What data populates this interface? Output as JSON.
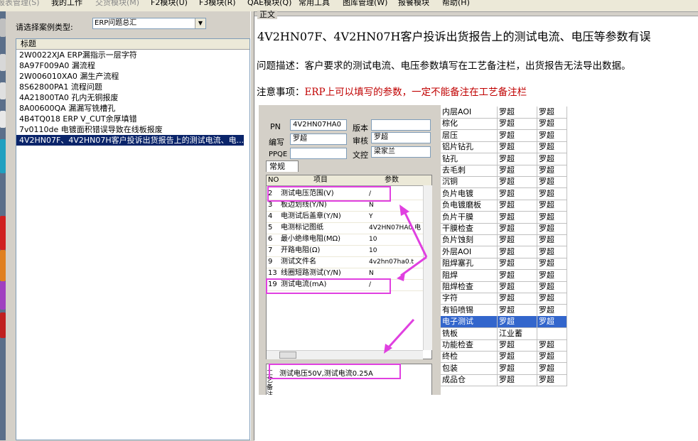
{
  "menubar": {
    "items": [
      "报表管理(S)",
      "我的工作",
      "交货模块(M)",
      "F2模块(U)",
      "F3模块(R)",
      "QAE模块(Q)",
      "常用工具",
      "图库管理(W)",
      "报餐模块",
      "帮助(H)"
    ]
  },
  "left": {
    "case_type_label": "请选择案例类型:",
    "case_type_value": "ERP问题总汇",
    "list_header": "标题",
    "items": [
      "2W0022XJA  ERP漏指示一层字符",
      "8A97F009A0  漏流程",
      "2W006010XA0 漏生产流程",
      "8S62800PA1 流程问题",
      "4A21800TA0    孔内无铜报废",
      "8A00600QA 漏漏写铣槽孔",
      "4B4TQ018 ERP V_CUT余厚填错",
      "7v0110de    电镀面积错误导致在线板报废",
      "4V2HN07F、4V2HN07H客户投诉出货报告上的测试电流、电..."
    ],
    "selected_index": 8
  },
  "content": {
    "legend": "正文",
    "title": "4V2HN07F、4V2HN07H客户投诉出货报告上的测试电流、电压等参数有误",
    "description": "问题描述：客户要求的测试电流、电压参数填写在工艺备注栏，出货报告无法导出数据。",
    "note_label": "注意事项：",
    "note_text": "ERP上可以填写的参数，一定不能备注在工艺备注栏"
  },
  "embed": {
    "form": {
      "pn_label": "PN",
      "pn_value": "4V2HN07HA0",
      "version_label": "版本",
      "version_value": "",
      "author_label": "编写",
      "author_value": "罗超",
      "review_label": "审核",
      "review_value": "罗超",
      "ppqe_label": "PPQE",
      "ppqe_value": "",
      "doc_label": "文控",
      "doc_value": "梁家兰",
      "tab_label": "常规",
      "grid_headers": {
        "no": "NO",
        "item": "项目",
        "param": "参数"
      },
      "grid_rows": [
        {
          "no": "2",
          "item": "测试电压范围(V)",
          "param": "/"
        },
        {
          "no": "3",
          "item": "板边划线(Y/N)",
          "param": "N"
        },
        {
          "no": "4",
          "item": "电测试后盖章(Y/N)",
          "param": "Y"
        },
        {
          "no": "5",
          "item": "电测标记图纸",
          "param": "4V2HN07HA0.电"
        },
        {
          "no": "6",
          "item": "最小绝缘电阻(MΩ)",
          "param": "10"
        },
        {
          "no": "7",
          "item": "开路电阻(Ω)",
          "param": "10"
        },
        {
          "no": "9",
          "item": "测试文件名",
          "param": "4v2hn07ha0.t"
        },
        {
          "no": "13",
          "item": "线圈短路测试(Y/N)",
          "param": "N"
        },
        {
          "no": "19",
          "item": "测试电流(mA)",
          "param": "/"
        }
      ],
      "memo_label": "工艺备注",
      "memo_text": "测试电压50V,测试电流0.25A"
    },
    "process_table": {
      "rows": [
        [
          "内层AOI",
          "罗超",
          "罗超"
        ],
        [
          "棕化",
          "罗超",
          "罗超"
        ],
        [
          "层压",
          "罗超",
          "罗超"
        ],
        [
          "铝片钻孔",
          "罗超",
          "罗超"
        ],
        [
          "钻孔",
          "罗超",
          "罗超"
        ],
        [
          "去毛刺",
          "罗超",
          "罗超"
        ],
        [
          "沉铜",
          "罗超",
          "罗超"
        ],
        [
          "负片电镀",
          "罗超",
          "罗超"
        ],
        [
          "负电镀磨板",
          "罗超",
          "罗超"
        ],
        [
          "负片干膜",
          "罗超",
          "罗超"
        ],
        [
          "干膜检查",
          "罗超",
          "罗超"
        ],
        [
          "负片蚀刻",
          "罗超",
          "罗超"
        ],
        [
          "外层AOI",
          "罗超",
          "罗超"
        ],
        [
          "阻焊塞孔",
          "罗超",
          "罗超"
        ],
        [
          "阻焊",
          "罗超",
          "罗超"
        ],
        [
          "阻焊检查",
          "罗超",
          "罗超"
        ],
        [
          "字符",
          "罗超",
          "罗超"
        ],
        [
          "有铅喷锡",
          "罗超",
          "罗超"
        ],
        [
          "电子测试",
          "罗超",
          "罗超"
        ],
        [
          "铣板",
          "江业蓄",
          ""
        ],
        [
          "功能检查",
          "罗超",
          "罗超"
        ],
        [
          "终检",
          "罗超",
          "罗超"
        ],
        [
          "包装",
          "罗超",
          "罗超"
        ],
        [
          "成品仓",
          "罗超",
          "罗超"
        ]
      ],
      "selected_index": 18
    }
  }
}
